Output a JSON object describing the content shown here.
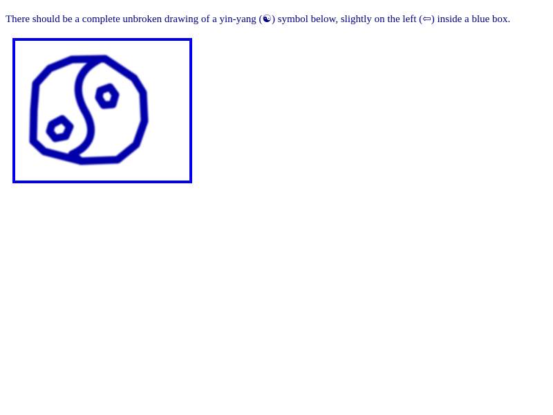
{
  "instruction": {
    "text": "There should be a complete unbroken drawing of a yin-yang (☯) symbol below, slightly on the left (⇦) inside a blue box."
  },
  "box": {
    "border_color": "#0000ee",
    "drawing_color": "#0000aa",
    "icon": "yin-yang-icon"
  }
}
